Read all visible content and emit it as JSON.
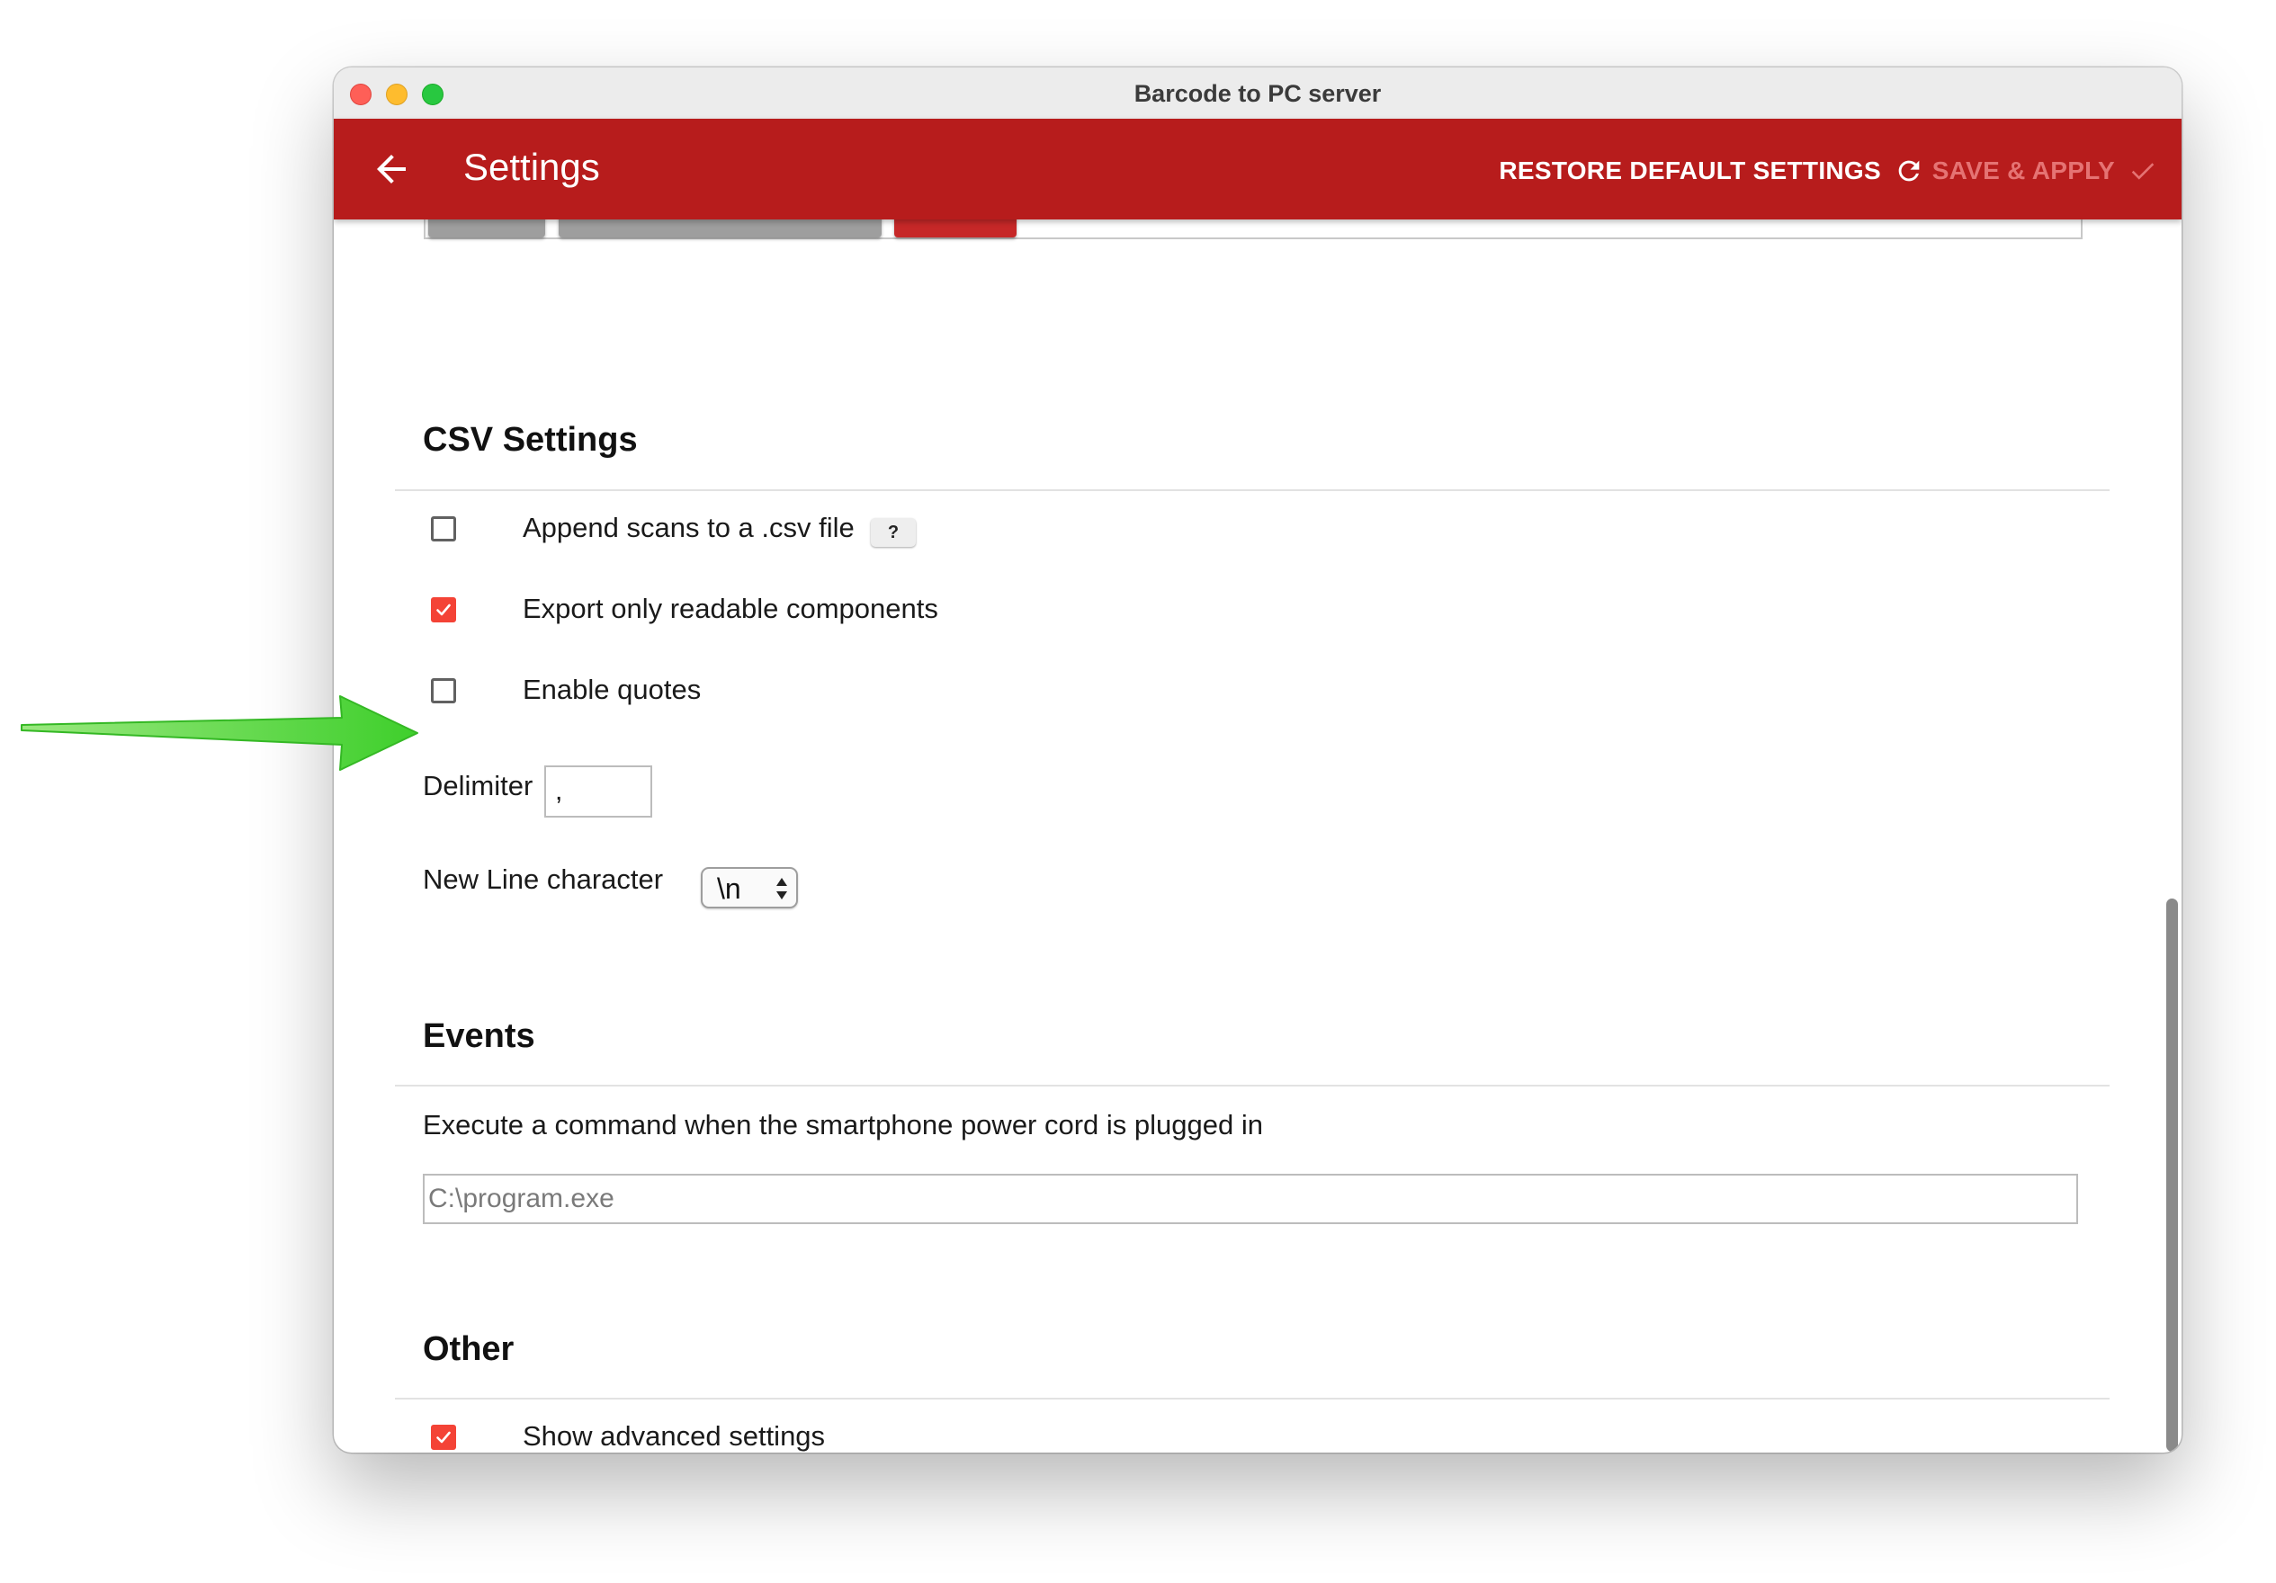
{
  "window": {
    "title": "Barcode to PC server"
  },
  "toolbar": {
    "title": "Settings",
    "restore_label": "RESTORE DEFAULT SETTINGS",
    "save_label": "SAVE & APPLY"
  },
  "csv": {
    "title": "CSV Settings",
    "append_label": "Append scans to a .csv file",
    "append_checked": false,
    "help_label": "?",
    "export_label": "Export only readable components",
    "export_checked": true,
    "quotes_label": "Enable quotes",
    "quotes_checked": false,
    "delimiter_label": "Delimiter",
    "delimiter_value": ",",
    "newline_label": "New Line character",
    "newline_value": "\\n"
  },
  "events": {
    "title": "Events",
    "command_label": "Execute a command when the smartphone power cord is plugged in",
    "command_placeholder": "C:\\program.exe",
    "command_value": ""
  },
  "other": {
    "title": "Other",
    "advanced_label": "Show advanced settings",
    "advanced_checked": true
  },
  "colors": {
    "toolbar": "#b71c1c",
    "checkbox_checked": "#f44336",
    "save_disabled": "#e57373",
    "annotation_arrow": "#4cd43c"
  },
  "icons": {
    "back": "arrow-left-icon",
    "restore": "refresh-icon",
    "save": "check-icon",
    "annotation": "green-arrow-icon"
  }
}
